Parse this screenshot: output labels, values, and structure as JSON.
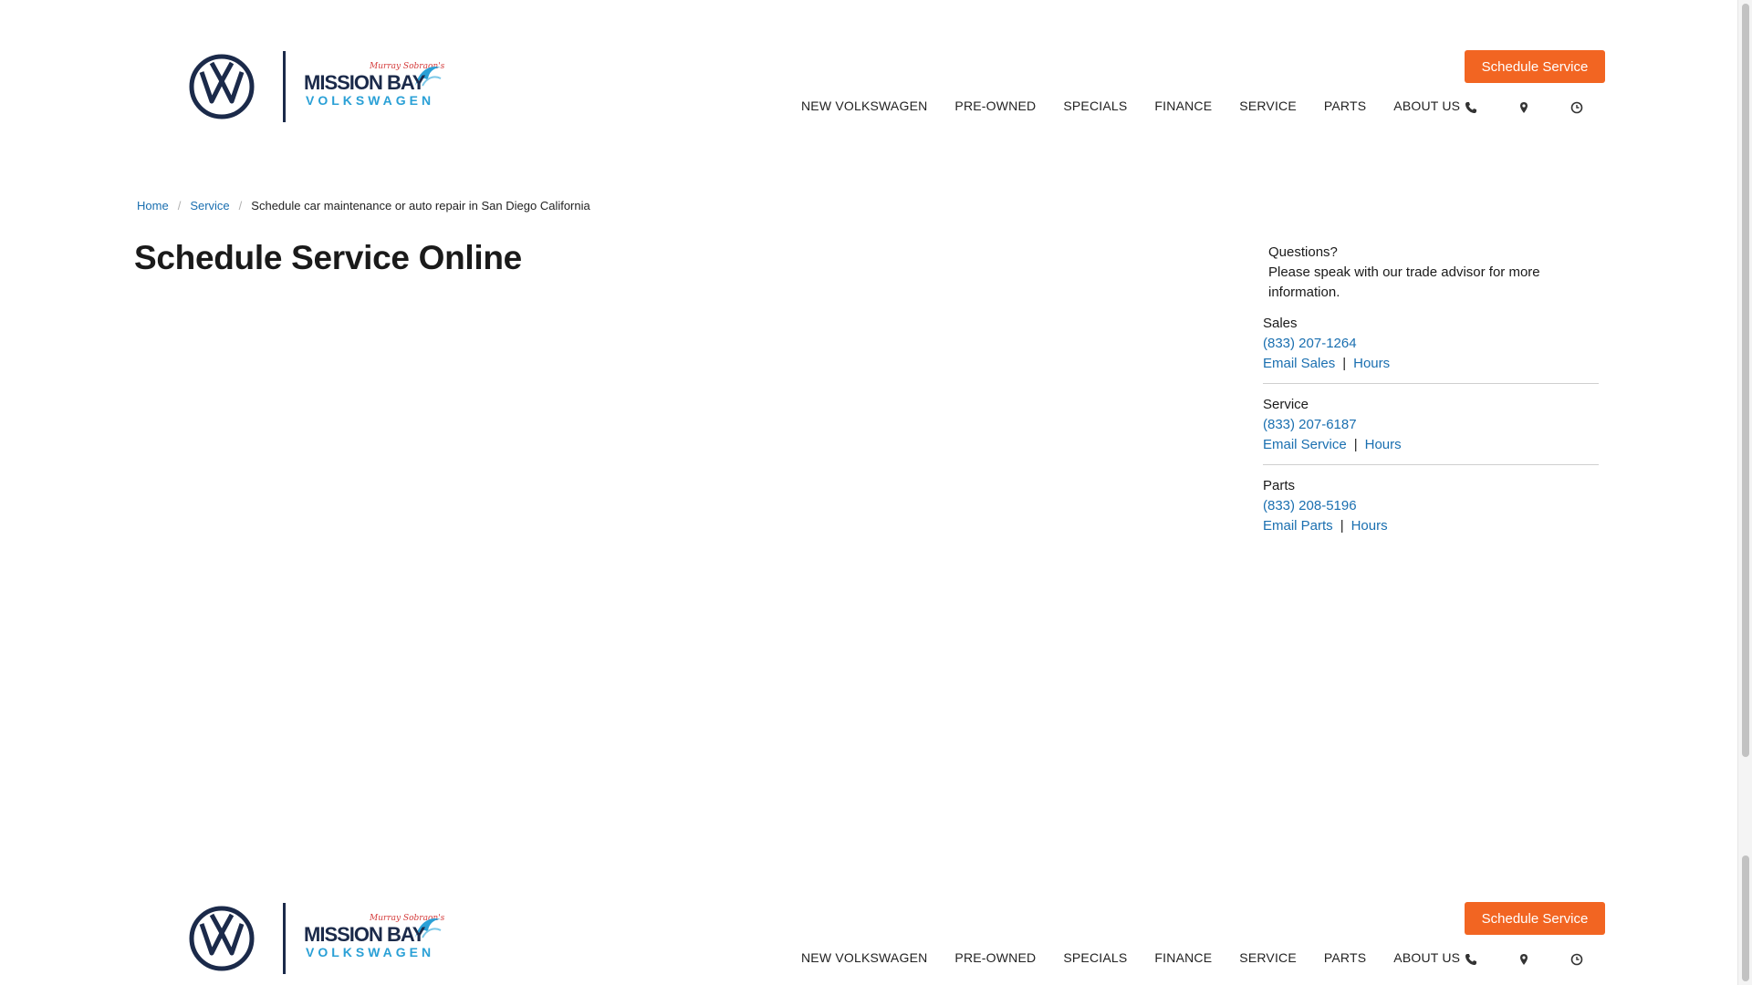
{
  "header": {
    "logo_alt": "Volkswagen logo",
    "dealer_line1": "MISSION BAY",
    "dealer_line2": "VOLKSWAGEN",
    "schedule_button": "Schedule Service",
    "nav": [
      "NEW VOLKSWAGEN",
      "PRE-OWNED",
      "SPECIALS",
      "FINANCE",
      "SERVICE",
      "PARTS",
      "ABOUT US"
    ],
    "icons": [
      "phone-icon",
      "map-pin-icon",
      "clock-icon"
    ]
  },
  "breadcrumb": {
    "home": "Home",
    "service": "Service",
    "separator": "/",
    "current": "Schedule car maintenance or auto repair in San Diego California"
  },
  "page_title": "Schedule Service Online",
  "sidebar": {
    "questions_line1": "Questions?",
    "questions_line2": "Please speak with our trade advisor for more information.",
    "departments": [
      {
        "name": "Sales",
        "phone": "(833) 207-1264",
        "email_label": "Email Sales",
        "hours_label": "Hours"
      },
      {
        "name": "Service",
        "phone": "(833) 207-6187",
        "email_label": "Email Service",
        "hours_label": "Hours"
      },
      {
        "name": "Parts",
        "phone": "(833) 208-5196",
        "email_label": "Email Parts",
        "hours_label": "Hours"
      }
    ],
    "link_separator": "|"
  },
  "colors": {
    "accent_orange": "#f26522",
    "link_blue": "#1a6fb0",
    "brand_navy": "#1b2a4a",
    "brand_cyan": "#2aa0d6"
  }
}
